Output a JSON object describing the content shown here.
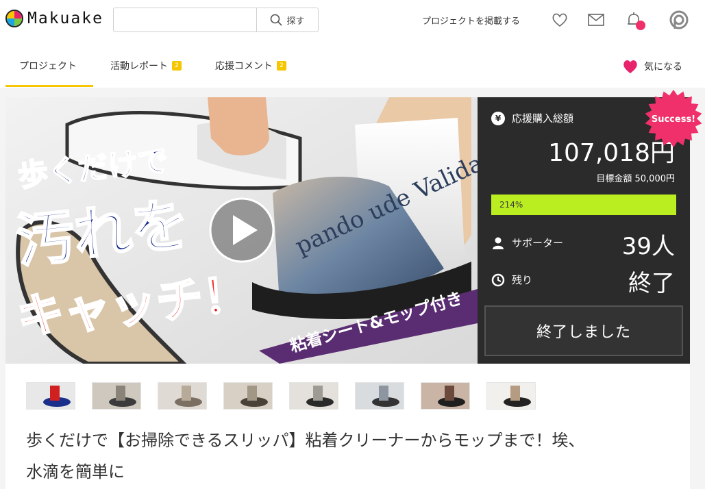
{
  "header": {
    "logo_text": "Makuake",
    "search": {
      "placeholder": "",
      "button_label": "探す"
    },
    "post_project_label": "プロジェクトを掲載する",
    "icons": [
      "heart-icon",
      "mail-icon",
      "bell-icon",
      "profile-icon"
    ]
  },
  "tabs": [
    {
      "label": "プロジェクト",
      "badge": ""
    },
    {
      "label": "活動レポート",
      "badge": "2"
    },
    {
      "label": "応援コメント",
      "badge": "2"
    }
  ],
  "favorite_label": "気になる",
  "hero": {
    "headline_1": "歩くだけで",
    "headline_2": "汚れを",
    "headline_3": "キャッチ！",
    "banner": "粘着シート&モップ付き",
    "shoe_text": "pando ude Valida"
  },
  "stats": {
    "amount_label": "応援購入総額",
    "amount_value": "107,018円",
    "goal_text": "目標金額 50,000円",
    "progress_percent": 214,
    "progress_label": "214%",
    "supporters_label": "サポーター",
    "supporters_value": "39人",
    "remaining_label": "残り",
    "remaining_value": "終了",
    "ended_button": "終了しました",
    "success_badge": "Success!"
  },
  "thumbnails_count": 8,
  "project_title_line1": "歩くだけで【お掃除できるスリッパ】粘着クリーナーからモップまで！埃、",
  "project_title_line2": "水滴を簡単に",
  "colors": {
    "accent_yellow": "#f6c700",
    "progress_green": "#bbee20",
    "panel_dark": "#2b2b2b",
    "success_pink": "#f0306a"
  }
}
